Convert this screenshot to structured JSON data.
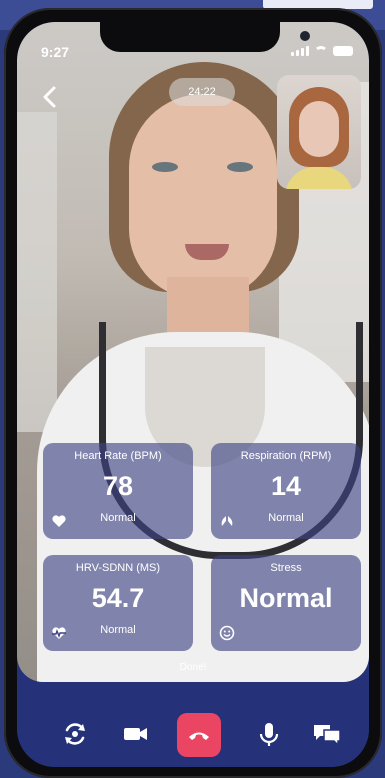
{
  "status": {
    "time": "9:27"
  },
  "call": {
    "timer": "24:22",
    "done_text": "Done!"
  },
  "metrics": [
    {
      "title": "Heart Rate (BPM)",
      "value": "78",
      "status": "Normal",
      "icon": "heart-icon"
    },
    {
      "title": "Respiration (RPM)",
      "value": "14",
      "status": "Normal",
      "icon": "lungs-icon"
    },
    {
      "title": "HRV-SDNN (MS)",
      "value": "54.7",
      "status": "Normal",
      "icon": "heartbeat-icon"
    },
    {
      "title": "Stress",
      "value": "Normal",
      "status": "",
      "icon": "smile-icon"
    }
  ],
  "controls": [
    "switch-camera-icon",
    "video-icon",
    "end-call-icon",
    "microphone-icon",
    "chat-icon"
  ],
  "colors": {
    "bottom_bar": "#25327a",
    "end_call": "#ea4663",
    "card_bg": "rgba(60,66,130,0.62)"
  }
}
